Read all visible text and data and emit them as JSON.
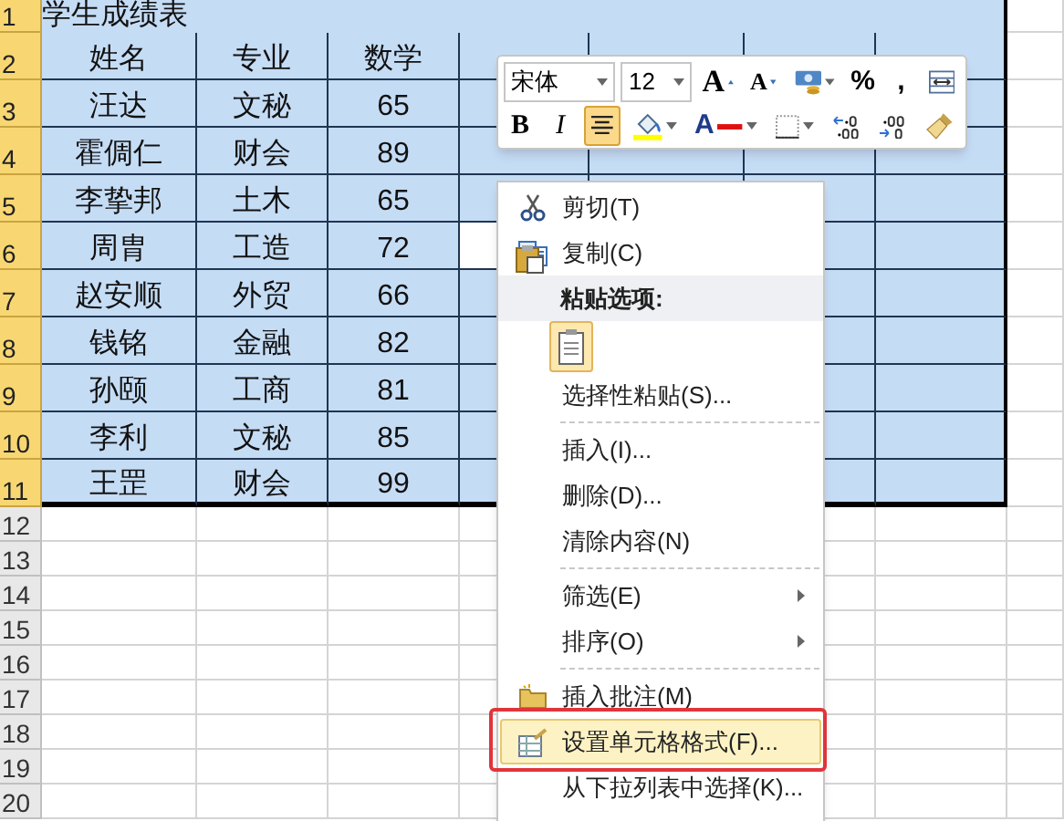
{
  "sheet": {
    "title_cell": "学生成绩表",
    "header_row": [
      "姓名",
      "专业",
      "数学"
    ],
    "rows": [
      {
        "cells": [
          "汪达",
          "文秘",
          "65"
        ],
        "column_d_selected": true
      },
      {
        "cells": [
          "霍倜仁",
          "财会",
          "89"
        ],
        "column_d_selected": true
      },
      {
        "cells": [
          "李挚邦",
          "土木",
          "65"
        ],
        "column_d_selected": true
      },
      {
        "cells": [
          "周胄",
          "工造",
          "72"
        ],
        "column_d_selected": false
      },
      {
        "cells": [
          "赵安顺",
          "外贸",
          "66"
        ],
        "column_d_selected": true
      },
      {
        "cells": [
          "钱铭",
          "金融",
          "82"
        ],
        "column_d_selected": true
      },
      {
        "cells": [
          "孙颐",
          "工商",
          "81"
        ],
        "column_d_selected": true
      },
      {
        "cells": [
          "李利",
          "文秘",
          "85"
        ],
        "column_d_selected": true
      },
      {
        "cells": [
          "王罡",
          "财会",
          "99"
        ],
        "column_d_selected": true
      }
    ],
    "row_numbers": [
      "1",
      "2",
      "3",
      "4",
      "5",
      "6",
      "7",
      "8",
      "9",
      "10",
      "11",
      "12",
      "13",
      "14",
      "15",
      "16",
      "17",
      "18",
      "19",
      "20"
    ]
  },
  "mini_toolbar": {
    "font": "宋体",
    "size": "12",
    "row_1": [
      {
        "kind": "grow",
        "label": "A"
      },
      {
        "kind": "shrink",
        "label": "A"
      },
      {
        "kind": "currency"
      },
      {
        "kind": "percent",
        "label": "%"
      },
      {
        "kind": "comma",
        "label": ","
      },
      {
        "kind": "merge"
      }
    ],
    "row_2": [
      {
        "kind": "bold",
        "label": "B",
        "selected": false
      },
      {
        "kind": "italic",
        "label": "I",
        "selected": false
      },
      {
        "kind": "center",
        "selected": true
      },
      {
        "kind": "fill"
      },
      {
        "kind": "font_color",
        "label": "A"
      },
      {
        "kind": "borders"
      },
      {
        "kind": "more_decimals"
      },
      {
        "kind": "fewer_decimals"
      },
      {
        "kind": "painter"
      }
    ]
  },
  "context_menu": {
    "items": [
      {
        "kind": "command",
        "label": "剪切(T)",
        "selected": false
      },
      {
        "kind": "command",
        "label": "复制(C)",
        "selected": false
      },
      {
        "kind": "header",
        "label": "粘贴选项:"
      },
      {
        "kind": "paste_option"
      },
      {
        "kind": "command",
        "label": "选择性粘贴(S)...",
        "selected": false
      },
      {
        "kind": "separator"
      },
      {
        "kind": "command",
        "label": "插入(I)...",
        "selected": false
      },
      {
        "kind": "command",
        "label": "删除(D)...",
        "selected": false
      },
      {
        "kind": "command",
        "label": "清除内容(N)",
        "selected": false
      },
      {
        "kind": "separator"
      },
      {
        "kind": "submenu",
        "label": "筛选(E)",
        "selected": false
      },
      {
        "kind": "submenu",
        "label": "排序(O)",
        "selected": false
      },
      {
        "kind": "separator"
      },
      {
        "kind": "command",
        "label": "插入批注(M)",
        "selected": false
      },
      {
        "kind": "command",
        "label": "设置单元格格式(F)...",
        "selected": true
      },
      {
        "kind": "command",
        "label": "从下拉列表中选择(K)...",
        "selected": false
      }
    ],
    "highlight_frame": true
  }
}
